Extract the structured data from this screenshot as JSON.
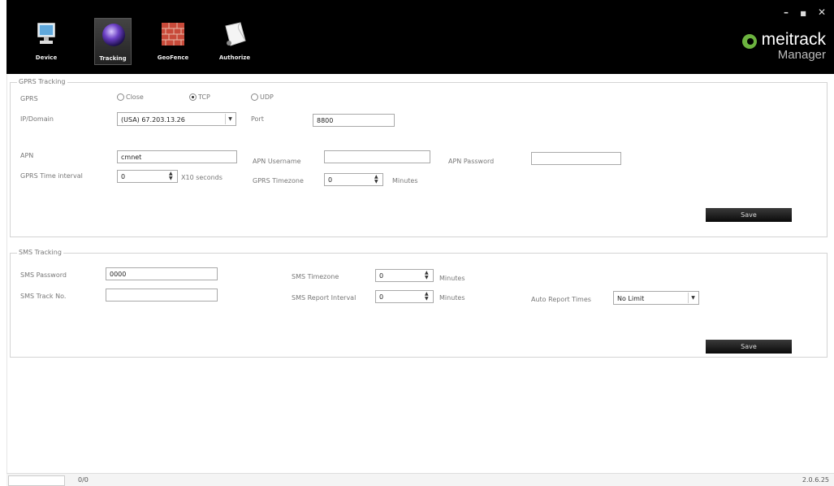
{
  "toolbar": {
    "items": [
      {
        "label": "Device",
        "icon": "monitor-icon"
      },
      {
        "label": "Tracking",
        "icon": "globe-icon"
      },
      {
        "label": "GeoFence",
        "icon": "brick-wall-icon"
      },
      {
        "label": "Authorize",
        "icon": "document-icon"
      }
    ],
    "active": "Tracking"
  },
  "window_controls": {
    "minimize": "–",
    "maximize": "■",
    "close": "✕"
  },
  "brand": {
    "name": "meitrack",
    "sub": "Manager",
    "accent": "#6cb33f"
  },
  "gprs": {
    "legend": "GPRS Tracking",
    "gprs_label": "GPRS",
    "radio_close": "Close",
    "radio_tcp": "TCP",
    "radio_udp": "UDP",
    "selected": "TCP",
    "ip_label": "IP/Domain",
    "ip_value": "(USA) 67.203.13.26",
    "port_label": "Port",
    "port_value": "8800",
    "apn_label": "APN",
    "apn_value": "cmnet",
    "apn_user_label": "APN Username",
    "apn_user_value": "",
    "apn_pass_label": "APN Password",
    "apn_pass_value": "",
    "interval_label": "GPRS Time interval",
    "interval_value": "0",
    "interval_unit": "X10 seconds",
    "timezone_label": "GPRS Timezone",
    "timezone_value": "0",
    "timezone_unit": "Minutes",
    "save": "Save"
  },
  "sms": {
    "legend": "SMS Tracking",
    "password_label": "SMS Password",
    "password_value": "0000",
    "track_label": "SMS Track No.",
    "track_value": "",
    "timezone_label": "SMS Timezone",
    "timezone_value": "0",
    "timezone_unit": "Minutes",
    "report_label": "SMS Report Interval",
    "report_value": "0",
    "report_unit": "Minutes",
    "auto_label": "Auto Report Times",
    "auto_value": "No Limit",
    "save": "Save"
  },
  "status": {
    "count": "0/0",
    "version": "2.0.6.25"
  }
}
